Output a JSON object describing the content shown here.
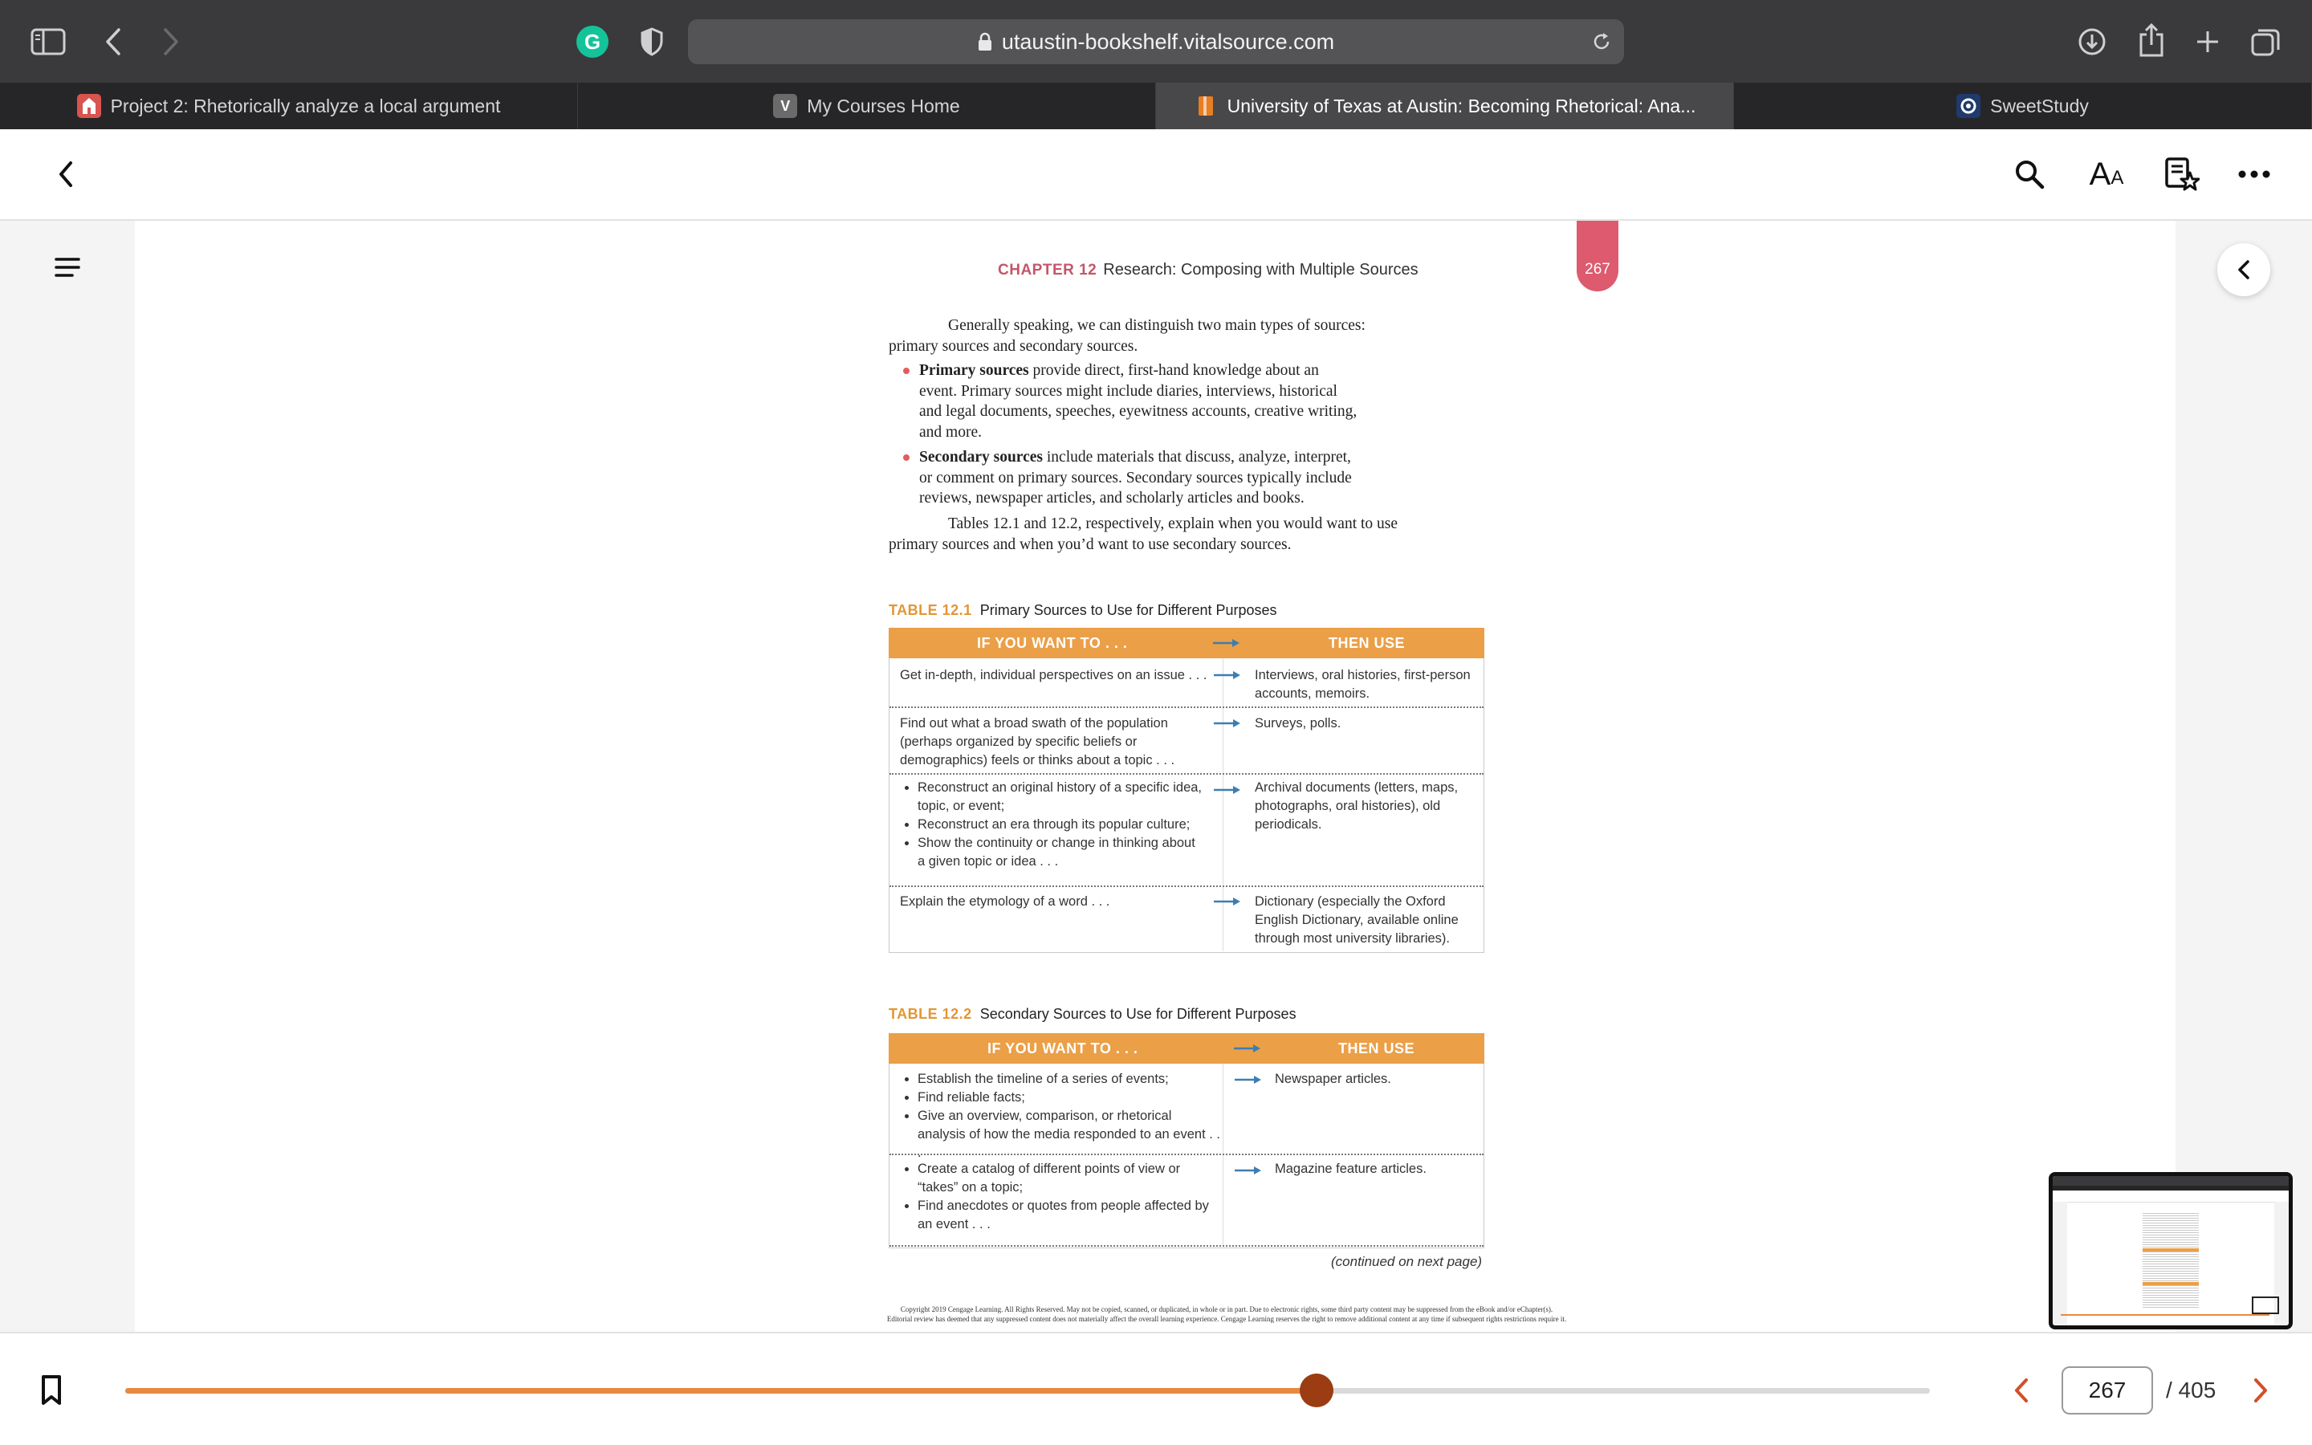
{
  "browser": {
    "url": "utaustin-bookshelf.vitalsource.com",
    "tabs": [
      {
        "label": "Project 2: Rhetorically analyze a local argument",
        "active": false,
        "favicon_color": "#d9534f"
      },
      {
        "label": "My Courses Home",
        "active": false,
        "favicon_letter": "V",
        "favicon_color": "#6b6b6b"
      },
      {
        "label": "University of Texas at Austin: Becoming Rhetorical: Ana...",
        "active": true,
        "favicon_color": "#e67e22"
      },
      {
        "label": "SweetStudy",
        "active": false,
        "favicon_color": "#1f3a6d"
      }
    ]
  },
  "reader": {
    "current_page": "267",
    "total_pages": "/ 405",
    "progress": 0.66
  },
  "book_page": {
    "chapter_label": "CHAPTER 12",
    "chapter_title": "Research: Composing with Multiple Sources",
    "page_number": "267",
    "intro_lines": [
      "Generally speaking, we can distinguish two main types of sources:",
      "primary sources and secondary sources."
    ],
    "bullets": [
      {
        "term": "Primary sources",
        "lines": [
          "provide direct, first-hand knowledge about an",
          "event. Primary sources might include diaries, interviews, historical",
          "and legal documents, speeches, eyewitness accounts, creative writing,",
          "and more."
        ]
      },
      {
        "term": "Secondary sources",
        "lines": [
          "include materials that discuss, analyze, interpret,",
          "or comment on primary sources. Secondary sources typically include",
          "reviews, newspaper articles, and scholarly articles and books."
        ]
      }
    ],
    "closing_lines": [
      "Tables 12.1 and 12.2, respectively, explain when you would want to use",
      "primary sources and when you’d want to use secondary sources."
    ],
    "table1": {
      "label": "TABLE 12.1",
      "title": "Primary Sources to Use for Different Purposes",
      "col_left": "IF YOU WANT TO . . .",
      "col_right": "THEN USE",
      "rows": [
        {
          "left": [
            "Get in-depth, individual perspectives on an issue . . ."
          ],
          "right": [
            "Interviews, oral histories, first-person",
            "accounts, memoirs."
          ]
        },
        {
          "left": [
            "Find out what a broad swath of the population",
            "(perhaps organized by specific beliefs or",
            "demographics) feels or thinks about a topic . . ."
          ],
          "right": [
            "Surveys, polls."
          ]
        },
        {
          "bullets": [
            "Reconstruct an original history of a specific idea, topic, or event;",
            "Reconstruct an era through its popular culture;",
            "Show the continuity or change in thinking about a given topic or idea . . ."
          ],
          "right": [
            "Archival documents (letters, maps,",
            "photographs, oral histories), old",
            "periodicals."
          ]
        },
        {
          "left": [
            "Explain the etymology of a word . . ."
          ],
          "right": [
            "Dictionary (especially the Oxford",
            "English Dictionary, available online",
            "through most university libraries)."
          ]
        }
      ]
    },
    "table2": {
      "label": "TABLE 12.2",
      "title": "Secondary Sources to Use for Different Purposes",
      "col_left": "IF YOU WANT TO . . .",
      "col_right": "THEN USE",
      "rows": [
        {
          "bullets": [
            "Establish the timeline of a series of events;",
            "Find reliable facts;",
            "Give an overview, comparison, or rhetorical analysis of how the media responded to an event . . ."
          ],
          "right": [
            "Newspaper articles."
          ]
        },
        {
          "bullets": [
            "Create a catalog of different points of view or “takes” on a topic;",
            "Find anecdotes or quotes from people affected by an event . . ."
          ],
          "right": [
            "Magazine feature articles."
          ]
        }
      ],
      "continued": "(continued on next page)"
    },
    "copyright_lines": [
      "Copyright 2019 Cengage Learning. All Rights Reserved. May not be copied, scanned, or duplicated, in whole or in part. Due to electronic rights, some third party content may be suppressed from the eBook and/or eChapter(s).",
      "Editorial review has deemed that any suppressed content does not materially affect the overall learning experience. Cengage Learning reserves the right to remove additional content at any time if subsequent rights restrictions require it."
    ]
  },
  "icons": {
    "sidebar": "sidebar-icon",
    "back": "chevron-left-icon",
    "forward": "chevron-right-icon",
    "grammarly": "grammarly-icon",
    "shield": "shield-icon",
    "lock": "lock-icon",
    "reload": "reload-icon",
    "download": "download-icon",
    "share": "share-icon",
    "new_tab": "plus-icon",
    "tabs_overview": "tabs-icon",
    "search": "search-icon",
    "text_size": "text-size-icon",
    "notes": "notes-star-icon",
    "more": "more-icon",
    "menu": "hamburger-icon",
    "bookmark": "bookmark-icon"
  },
  "colors": {
    "accent_orange": "#eb9f47",
    "chapter_pink": "#dd5a6f",
    "progress": "#e8893e",
    "thumb": "#9b3c12",
    "nav_arrow": "#d0502a"
  }
}
